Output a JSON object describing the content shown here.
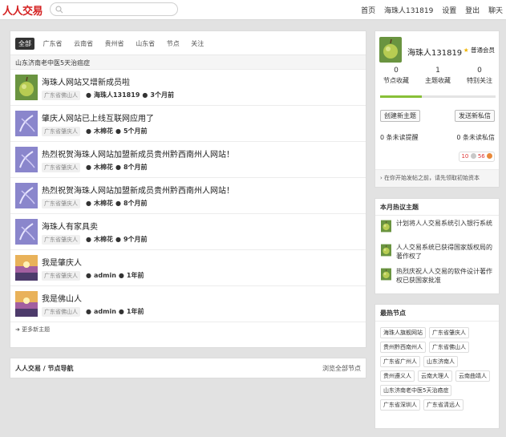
{
  "header": {
    "logo": "人人交易",
    "search_placeholder": "",
    "nav": [
      "首页",
      "海珠人131819",
      "设置",
      "登出",
      "聊天"
    ]
  },
  "tabs": [
    {
      "label": "全部",
      "active": true
    },
    {
      "label": "广东省"
    },
    {
      "label": "云南省"
    },
    {
      "label": "贵州省"
    },
    {
      "label": "山东省"
    },
    {
      "label": "节点"
    },
    {
      "label": "关注"
    }
  ],
  "crumb": "山东济南老中医5天治癌症",
  "topics": [
    {
      "title": "海珠人网站又增新成员啦",
      "node": "广东省佛山人",
      "user": "海珠人131819",
      "time": "3个月前",
      "avatar": "pear-icon"
    },
    {
      "title": "肇庆人网站已上线互联网应用了",
      "node": "广东省肇庆人",
      "user": "木棉花",
      "time": "5个月前",
      "avatar": "flower-icon"
    },
    {
      "title": "热烈祝贺海珠人网站加盟新成员贵州黔西南州人网站！",
      "node": "广东省肇庆人",
      "user": "木棉花",
      "time": "8个月前",
      "avatar": "flower-icon"
    },
    {
      "title": "热烈祝贺海珠人网站加盟新成员贵州黔西南州人网站！",
      "node": "广东省肇庆人",
      "user": "木棉花",
      "time": "8个月前",
      "avatar": "flower-icon"
    },
    {
      "title": "海珠人有家具卖",
      "node": "广东省肇庆人",
      "user": "木棉花",
      "time": "9个月前",
      "avatar": "flower-icon"
    },
    {
      "title": "我是肇庆人",
      "node": "广东省肇庆人",
      "user": "admin",
      "time": "1年前",
      "avatar": "sunset-icon"
    },
    {
      "title": "我是佛山人",
      "node": "广东省佛山人",
      "user": "admin",
      "time": "1年前",
      "avatar": "sunset-icon"
    }
  ],
  "more_link": "➜ 更多新主题",
  "node_nav": {
    "title": "人人交易 / 节点导航",
    "all": "浏览全部节点"
  },
  "user_panel": {
    "name": "海珠人131819",
    "badge": "普通会员",
    "stats": [
      {
        "num": "0",
        "label": "节点收藏"
      },
      {
        "num": "1",
        "label": "主题收藏"
      },
      {
        "num": "0",
        "label": "特别关注"
      }
    ],
    "progress": 0.36,
    "new_topic": "创建新主题",
    "send_pm": "发送新私信",
    "unread_reminders": "0 条未读提醒",
    "unread_pm": "0 条未读私信",
    "coins_silver": "10",
    "coins_gold": "56",
    "hint": "› 在你开始发帖之前，请先领取初始资本"
  },
  "hot_topics": {
    "title": "本月热议主题",
    "items": [
      "计划将人人交易系统引入银行系统",
      "人人交易系统已获得国家版权局的著作权了",
      "热烈庆祝人人交易的软件设计著作权已获国家批准"
    ]
  },
  "hot_nodes": {
    "title": "最热节点",
    "items": [
      "海珠人旗舰网站",
      "广东省肇庆人",
      "贵州黔西南州人",
      "广东省佛山人",
      "广东省广州人",
      "山东济南人",
      "贵州遵义人",
      "云南大理人",
      "云南曲靖人",
      "山东济南老中医5天治癌症",
      "广东省深圳人",
      "广东省清远人"
    ]
  },
  "colors": {
    "accent_red": "#d41f1f",
    "progress_green": "#88c038",
    "tab_active": "#333333"
  }
}
